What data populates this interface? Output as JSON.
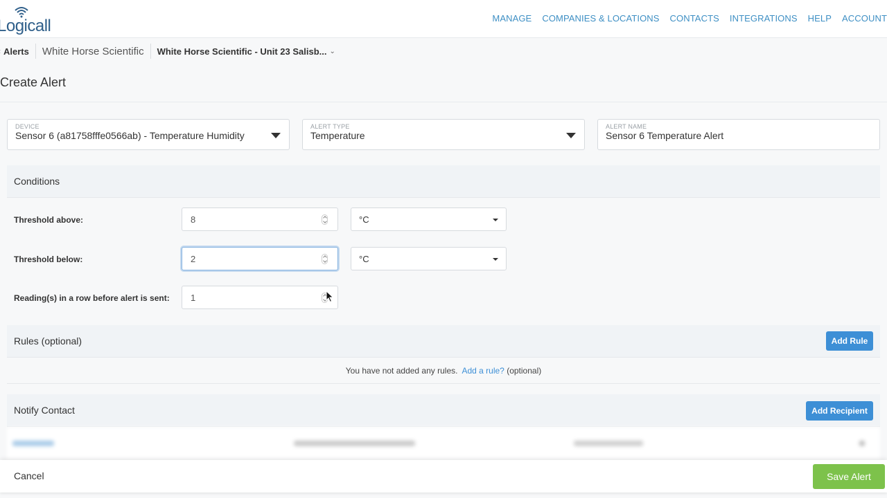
{
  "header": {
    "logo_text": "Logicall",
    "nav": [
      "MANAGE",
      "COMPANIES & LOCATIONS",
      "CONTACTS",
      "INTEGRATIONS",
      "HELP",
      "ACCOUNT"
    ]
  },
  "breadcrumb": {
    "back_icon": "chevron-left-icon",
    "items": [
      "Alerts",
      "White Horse Scientific",
      "White Horse Scientific - Unit 23 Salisb..."
    ],
    "dropdown_icon": "chevron-down-icon"
  },
  "page": {
    "title": "Create Alert"
  },
  "form": {
    "device": {
      "label": "DEVICE",
      "value": "Sensor 6 (a81758fffe0566ab) - Temperature Humidity"
    },
    "alert_type": {
      "label": "ALERT TYPE",
      "value": "Temperature"
    },
    "alert_name": {
      "label": "ALERT NAME",
      "value": "Sensor 6 Temperature Alert"
    }
  },
  "conditions": {
    "title": "Conditions",
    "threshold_above": {
      "label": "Threshold above:",
      "value": "8",
      "unit": "°C"
    },
    "threshold_below": {
      "label": "Threshold below:",
      "value": "2",
      "unit": "°C"
    },
    "readings_in_row": {
      "label": "Reading(s) in a row before alert is sent:",
      "value": "1"
    }
  },
  "rules": {
    "title": "Rules (optional)",
    "add_button": "Add Rule",
    "empty_text": "You have not added any rules.",
    "add_link": "Add a rule?",
    "optional_text": "(optional)"
  },
  "notify": {
    "title": "Notify Contact",
    "add_button": "Add Recipient"
  },
  "footer": {
    "cancel": "Cancel",
    "save": "Save Alert"
  },
  "colors": {
    "nav_link": "#3e8fc4",
    "primary_button": "#3d8fd6",
    "save_button": "#7dc24b"
  }
}
